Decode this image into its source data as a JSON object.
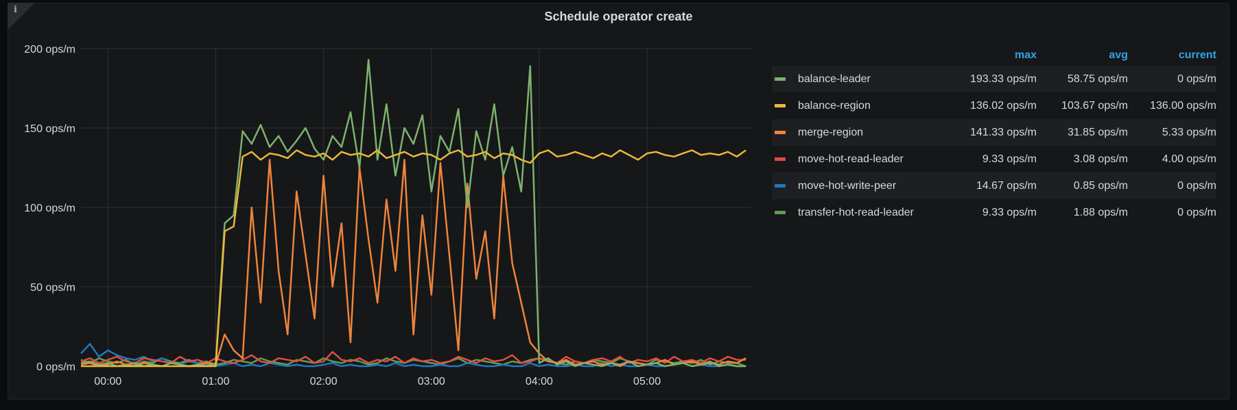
{
  "panel": {
    "title": "Schedule operator create",
    "info_icon": "i"
  },
  "legend": {
    "headers": {
      "max": "max",
      "avg": "avg",
      "current": "current"
    },
    "rows": [
      {
        "name": "balance-leader",
        "color": "#7eb26d",
        "max": "193.33 ops/m",
        "avg": "58.75 ops/m",
        "current": "0 ops/m"
      },
      {
        "name": "balance-region",
        "color": "#eab839",
        "max": "136.02 ops/m",
        "avg": "103.67 ops/m",
        "current": "136.00 ops/m"
      },
      {
        "name": "merge-region",
        "color": "#ef843c",
        "max": "141.33 ops/m",
        "avg": "31.85 ops/m",
        "current": "5.33 ops/m"
      },
      {
        "name": "move-hot-read-leader",
        "color": "#e24d42",
        "max": "9.33 ops/m",
        "avg": "3.08 ops/m",
        "current": "4.00 ops/m"
      },
      {
        "name": "move-hot-write-peer",
        "color": "#1f78c1",
        "max": "14.67 ops/m",
        "avg": "0.85 ops/m",
        "current": "0 ops/m"
      },
      {
        "name": "transfer-hot-read-leader",
        "color": "#629e51",
        "max": "9.33 ops/m",
        "avg": "1.88 ops/m",
        "current": "0 ops/m"
      }
    ]
  },
  "chart_data": {
    "type": "line",
    "title": "Schedule operator create",
    "xlabel": "",
    "ylabel": "",
    "x_unit": "minutes from 00:00",
    "x_start": -15,
    "x_step": 5,
    "xlim": [
      -15,
      358
    ],
    "ylim": [
      0,
      200
    ],
    "yticks": [
      0,
      50,
      100,
      150,
      200
    ],
    "ytick_labels": [
      "0 ops/m",
      "50 ops/m",
      "100 ops/m",
      "150 ops/m",
      "200 ops/m"
    ],
    "xticks": [
      0,
      60,
      120,
      180,
      240,
      300
    ],
    "xtick_labels": [
      "00:00",
      "01:00",
      "02:00",
      "03:00",
      "04:00",
      "05:00"
    ],
    "grid": true,
    "legend_position": "right",
    "series": [
      {
        "name": "transfer-hot-read-leader",
        "color": "#629e51",
        "values": [
          4,
          2,
          5,
          3,
          2,
          4,
          1,
          3,
          2,
          5,
          3,
          2,
          4,
          2,
          3,
          1,
          2,
          4,
          3,
          2,
          5,
          3,
          2,
          1,
          4,
          3,
          2,
          5,
          3,
          2,
          4,
          3,
          1,
          2,
          5,
          3,
          2,
          4,
          3,
          2,
          1,
          3,
          5,
          2,
          4,
          3,
          2,
          1,
          3,
          2,
          4,
          5,
          3,
          2,
          1,
          3,
          2,
          4,
          3,
          2,
          5,
          3,
          2,
          1,
          4,
          3,
          2,
          3,
          2,
          4,
          1,
          3,
          2,
          2,
          0
        ]
      },
      {
        "name": "move-hot-write-peer",
        "color": "#1f78c1",
        "values": [
          8,
          14,
          6,
          10,
          7,
          5,
          4,
          6,
          3,
          5,
          2,
          1,
          3,
          2,
          1,
          0,
          1,
          2,
          0,
          1,
          0,
          2,
          1,
          0,
          1,
          0,
          0,
          1,
          2,
          0,
          1,
          0,
          0,
          1,
          0,
          2,
          0,
          1,
          0,
          0,
          1,
          0,
          0,
          2,
          1,
          0,
          0,
          1,
          0,
          0,
          2,
          0,
          1,
          0,
          0,
          1,
          0,
          0,
          2,
          0,
          1,
          0,
          0,
          1,
          0,
          0,
          1,
          2,
          0,
          1,
          0,
          0,
          1,
          0,
          0
        ]
      },
      {
        "name": "move-hot-read-leader",
        "color": "#e24d42",
        "values": [
          3,
          5,
          2,
          4,
          6,
          3,
          2,
          5,
          4,
          3,
          2,
          6,
          3,
          4,
          2,
          5,
          3,
          2,
          4,
          7,
          3,
          2,
          5,
          4,
          3,
          6,
          2,
          3,
          9,
          4,
          3,
          5,
          2,
          4,
          3,
          6,
          2,
          5,
          3,
          4,
          2,
          3,
          6,
          4,
          2,
          5,
          3,
          4,
          7,
          2,
          3,
          5,
          4,
          2,
          6,
          3,
          2,
          4,
          5,
          3,
          6,
          2,
          4,
          3,
          5,
          2,
          6,
          3,
          4,
          2,
          5,
          3,
          6,
          4,
          4
        ]
      },
      {
        "name": "merge-region",
        "color": "#ef843c",
        "values": [
          1,
          2,
          0,
          1,
          3,
          1,
          0,
          2,
          1,
          0,
          2,
          1,
          0,
          1,
          2,
          1,
          20,
          10,
          5,
          100,
          40,
          130,
          60,
          20,
          110,
          70,
          30,
          120,
          50,
          90,
          15,
          125,
          80,
          40,
          105,
          60,
          130,
          20,
          95,
          45,
          128,
          70,
          10,
          115,
          55,
          85,
          30,
          120,
          65,
          40,
          15,
          8,
          3,
          2,
          4,
          1,
          2,
          3,
          1,
          2,
          0,
          3,
          2,
          1,
          2,
          4,
          1,
          2,
          3,
          1,
          2,
          1,
          3,
          2,
          5
        ]
      },
      {
        "name": "balance-leader",
        "color": "#7eb26d",
        "values": [
          2,
          3,
          1,
          2,
          0,
          1,
          2,
          0,
          1,
          0,
          2,
          1,
          0,
          1,
          0,
          2,
          90,
          95,
          148,
          140,
          152,
          138,
          145,
          135,
          142,
          150,
          137,
          130,
          145,
          138,
          160,
          125,
          193,
          130,
          165,
          120,
          150,
          140,
          158,
          110,
          145,
          135,
          162,
          100,
          148,
          130,
          165,
          120,
          138,
          110,
          189,
          2,
          5,
          1,
          3,
          0,
          2,
          1,
          0,
          2,
          1,
          3,
          0,
          1,
          2,
          0,
          1,
          2,
          0,
          1,
          3,
          0,
          1,
          0,
          0
        ]
      },
      {
        "name": "balance-region",
        "color": "#eab839",
        "values": [
          0,
          0,
          0,
          0,
          0,
          0,
          0,
          0,
          0,
          0,
          0,
          0,
          0,
          0,
          0,
          0,
          85,
          88,
          132,
          135,
          130,
          134,
          133,
          131,
          136,
          133,
          132,
          134,
          130,
          135,
          133,
          134,
          132,
          136,
          131,
          133,
          135,
          132,
          134,
          133,
          130,
          134,
          136,
          132,
          133,
          135,
          131,
          134,
          133,
          130,
          128,
          134,
          136,
          132,
          133,
          135,
          133,
          131,
          134,
          132,
          136,
          133,
          130,
          134,
          135,
          133,
          132,
          134,
          136,
          133,
          134,
          133,
          135,
          132,
          136
        ]
      }
    ]
  }
}
